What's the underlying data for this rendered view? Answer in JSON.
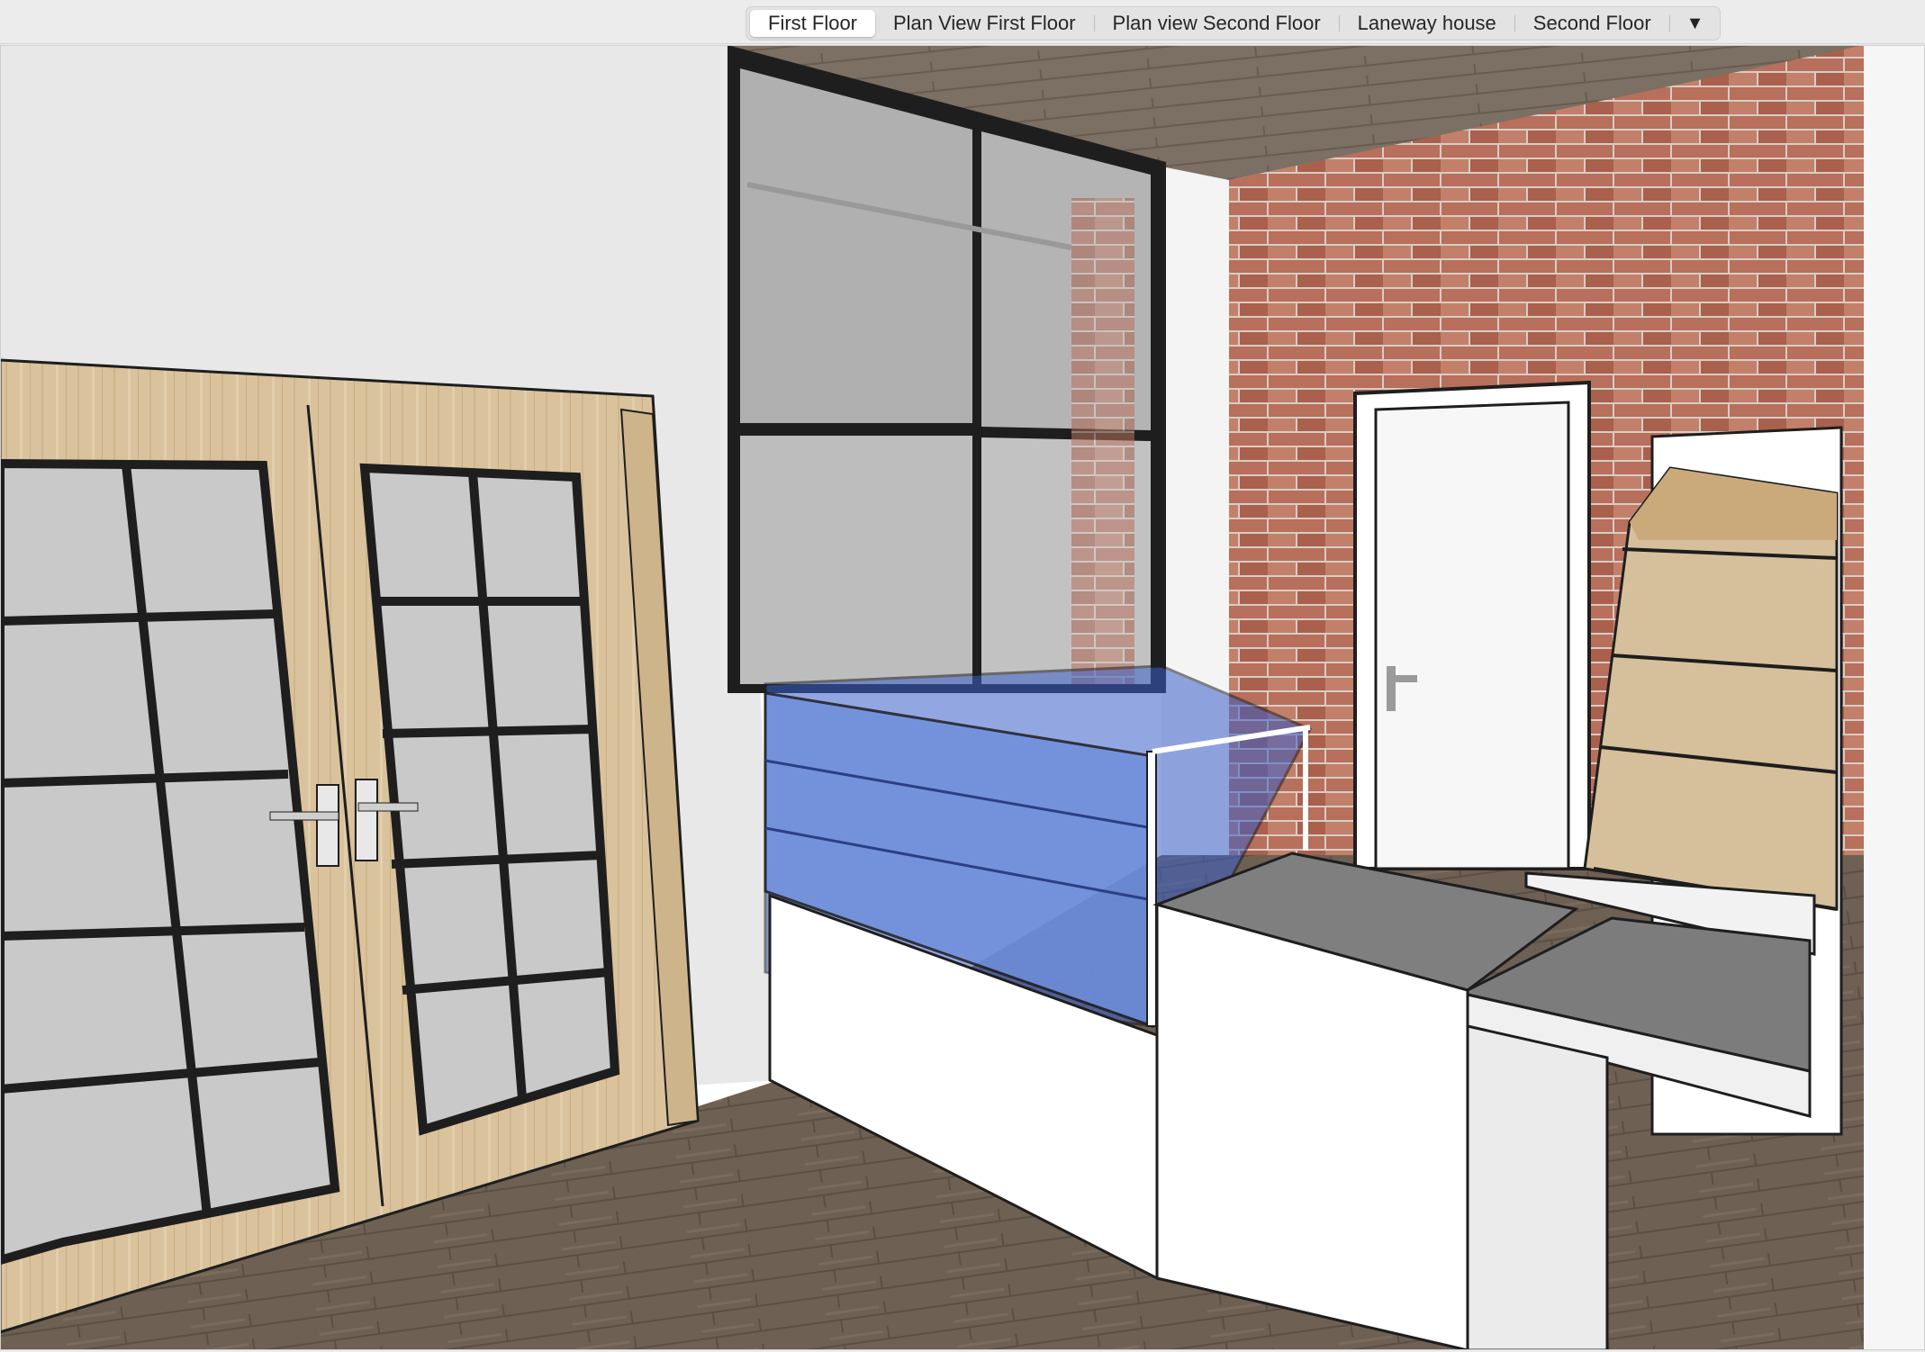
{
  "app": {
    "scene_tabs": [
      {
        "label": "First Floor",
        "active": true
      },
      {
        "label": "Plan View First Floor",
        "active": false
      },
      {
        "label": "Plan view Second Floor",
        "active": false
      },
      {
        "label": "Laneway house",
        "active": false
      },
      {
        "label": "Second Floor",
        "active": false
      }
    ],
    "overflow_icon": "triangle-down-icon",
    "overflow_glyph": "▼"
  },
  "colors": {
    "wall": "#e6e6e6",
    "brick": "#b7705d",
    "mortar": "#d9cfc8",
    "wood_floor": "#6b5c4f",
    "wood_door": "#d8c09a",
    "glass_blue": "#6f8fdc",
    "counter_top": "#7f7f7f",
    "frame_black": "#1e1e1e"
  }
}
